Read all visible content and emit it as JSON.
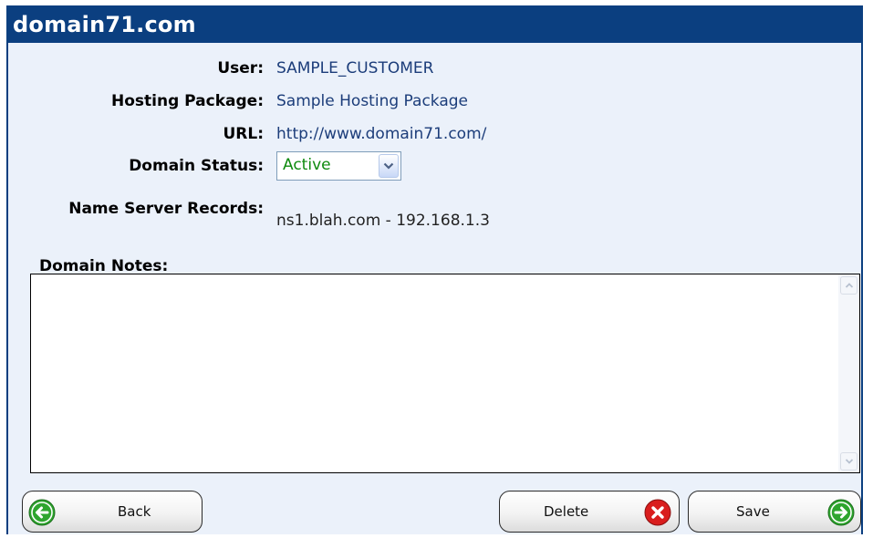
{
  "title": "domain71.com",
  "fields": {
    "user_label": "User:",
    "user_value": "SAMPLE_CUSTOMER",
    "package_label": "Hosting Package:",
    "package_value": "Sample Hosting Package",
    "url_label": "URL:",
    "url_value": "http://www.domain71.com/",
    "status_label": "Domain Status:",
    "status_value": "Active",
    "nameserver_label": "Name Server Records:",
    "nameserver_value": "ns1.blah.com - 192.168.1.3"
  },
  "notes": {
    "label": "Domain Notes:",
    "value": ""
  },
  "buttons": {
    "back": "Back",
    "delete": "Delete",
    "save": "Save"
  },
  "icons": {
    "back": "arrow-left-circle-icon",
    "delete": "x-circle-icon",
    "save": "arrow-right-circle-icon",
    "dropdown": "chevron-down-icon"
  },
  "colors": {
    "title_bar": "#0b3f80",
    "panel_bg": "#ebf1fa",
    "status_active": "#0e8a0e",
    "back_icon": "#2ea52e",
    "save_icon": "#2ea52e",
    "delete_icon": "#d91e1e"
  }
}
